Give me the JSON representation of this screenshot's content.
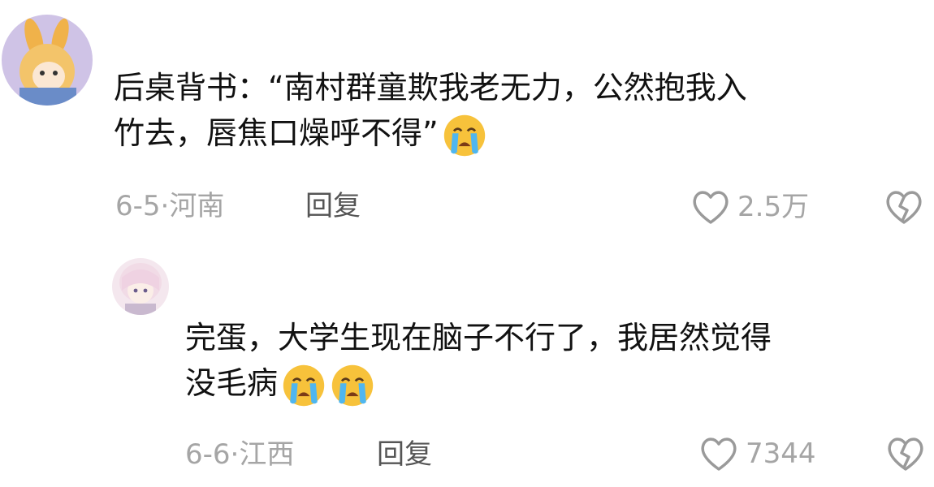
{
  "comments": [
    {
      "text": "后桌背书：“南村群童欺我老无力，公然抱我入竹去，唇焦口燥呼不得”",
      "line1": "后桌背书：“南村群童欺我老无力，公然抱我入",
      "line2": "竹去，唇焦口燥呼不得”",
      "emoji_count": 1,
      "date": "6-5·",
      "location": "河南",
      "reply_label": "回复",
      "like_count": "2.5万"
    },
    {
      "text": "完蛋，大学生现在脑子不行了，我居然觉得没毛病",
      "line1": "完蛋，大学生现在脑子不行了，我居然觉得",
      "line2": "没毛病",
      "emoji_count": 2,
      "date": "6-6·",
      "location": "江西",
      "reply_label": "回复",
      "like_count": "7344"
    }
  ],
  "icons": {
    "emoji": "crying-face-icon",
    "like": "heart-outline-icon",
    "dislike": "broken-heart-icon"
  },
  "colors": {
    "meta_gray": "#a5a5a5",
    "emoji_yellow": "#f7c23b",
    "tear_blue": "#4fb6ef"
  }
}
